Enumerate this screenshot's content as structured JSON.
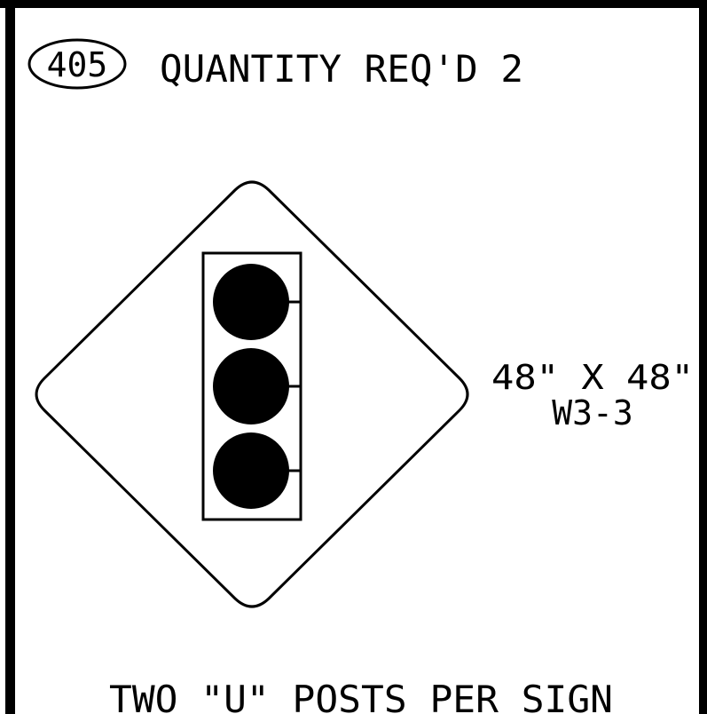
{
  "callout": {
    "number": "405",
    "quantity_label": "QUANTITY REQ'D 2"
  },
  "sign": {
    "size": "48\" X 48\"",
    "code": "W3-3",
    "symbol_icon": "traffic-signal-icon"
  },
  "note": "TWO \"U\" POSTS PER SIGN"
}
